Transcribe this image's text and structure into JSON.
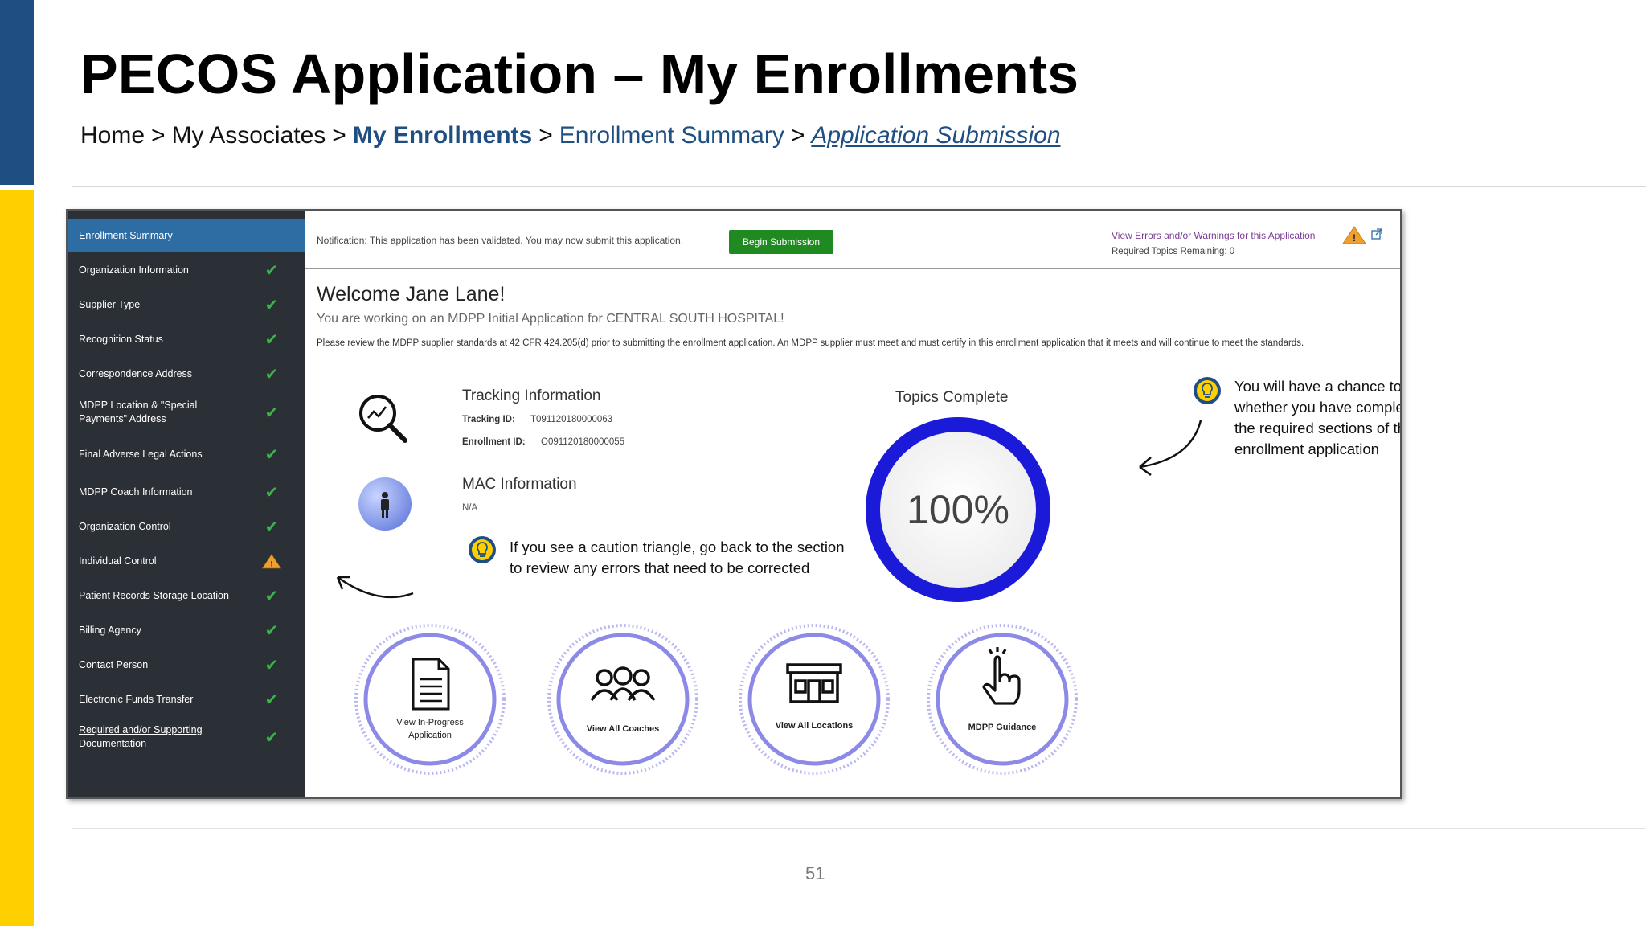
{
  "slide": {
    "title": "PECOS Application – My Enrollments",
    "breadcrumb": {
      "home": "Home",
      "associates": "My Associates",
      "enrollments": "My Enrollments",
      "summary": "Enrollment Summary",
      "submission": "Application Submission",
      "separator": ">"
    },
    "page_number": "51"
  },
  "colors": {
    "brand_blue": "#1f4e82",
    "accent_yellow": "#ffd000",
    "sidebar": "#2b2f36",
    "active": "#2e6da4",
    "success": "#3cb34a",
    "button_green": "#1f8a1f",
    "ring": "#1a1ad8",
    "warning": "#f0a030"
  },
  "sidebar": {
    "items": [
      {
        "label": "Enrollment Summary",
        "status": "active"
      },
      {
        "label": "Organization Information",
        "status": "check-icon"
      },
      {
        "label": "Supplier Type",
        "status": "check-icon"
      },
      {
        "label": "Recognition Status",
        "status": "check-icon"
      },
      {
        "label": "Correspondence Address",
        "status": "check-icon"
      },
      {
        "label": "MDPP Location & \"Special Payments\" Address",
        "status": "check-icon"
      },
      {
        "label": "Final Adverse Legal Actions",
        "status": "check-icon"
      },
      {
        "label": "MDPP Coach Information",
        "status": "check-icon"
      },
      {
        "label": "Organization Control",
        "status": "check-icon"
      },
      {
        "label": "Individual Control",
        "status": "warning-triangle-icon"
      },
      {
        "label": "Patient Records Storage Location",
        "status": "check-icon"
      },
      {
        "label": "Billing Agency",
        "status": "check-icon"
      },
      {
        "label": "Contact Person",
        "status": "check-icon"
      },
      {
        "label": "Electronic Funds Transfer",
        "status": "check-icon"
      },
      {
        "label": "Required and/or Supporting Documentation",
        "status": "check-icon"
      }
    ]
  },
  "notification": {
    "text": "Notification: This application has been validated. You may now submit this application.",
    "button": "Begin Submission",
    "view_errors": "View Errors and/or Warnings for this Application",
    "required_topics": "Required Topics Remaining: 0"
  },
  "welcome": {
    "heading": "Welcome Jane Lane!",
    "working_on": "You are working on an MDPP Initial Application for CENTRAL SOUTH HOSPITAL!",
    "review": "Please review the MDPP supplier standards at 42 CFR 424.205(d) prior to submitting the enrollment application. An MDPP supplier must meet and must certify in this enrollment application that it meets and will continue to meet the standards."
  },
  "tracking": {
    "title": "Tracking Information",
    "tracking_id_label": "Tracking ID:",
    "tracking_id": "T091120180000063",
    "enrollment_id_label": "Enrollment ID:",
    "enrollment_id": "O091120180000055"
  },
  "mac": {
    "title": "MAC Information",
    "value": "N/A"
  },
  "topics": {
    "title": "Topics Complete",
    "percent": "100%",
    "fraction": 1.0
  },
  "callouts": {
    "caution": "If you see a caution triangle, go back to the section to review any errors that need to be corrected",
    "chance": "You will have a chance to see whether you have completed all the required sections of the MDPP enrollment application"
  },
  "actions": [
    {
      "label": "View In-Progress Application",
      "icon": "document-icon"
    },
    {
      "label": "View All Coaches",
      "icon": "people-icon"
    },
    {
      "label": "View All Locations",
      "icon": "building-icon"
    },
    {
      "label": "MDPP Guidance",
      "icon": "pointing-hand-icon"
    }
  ]
}
